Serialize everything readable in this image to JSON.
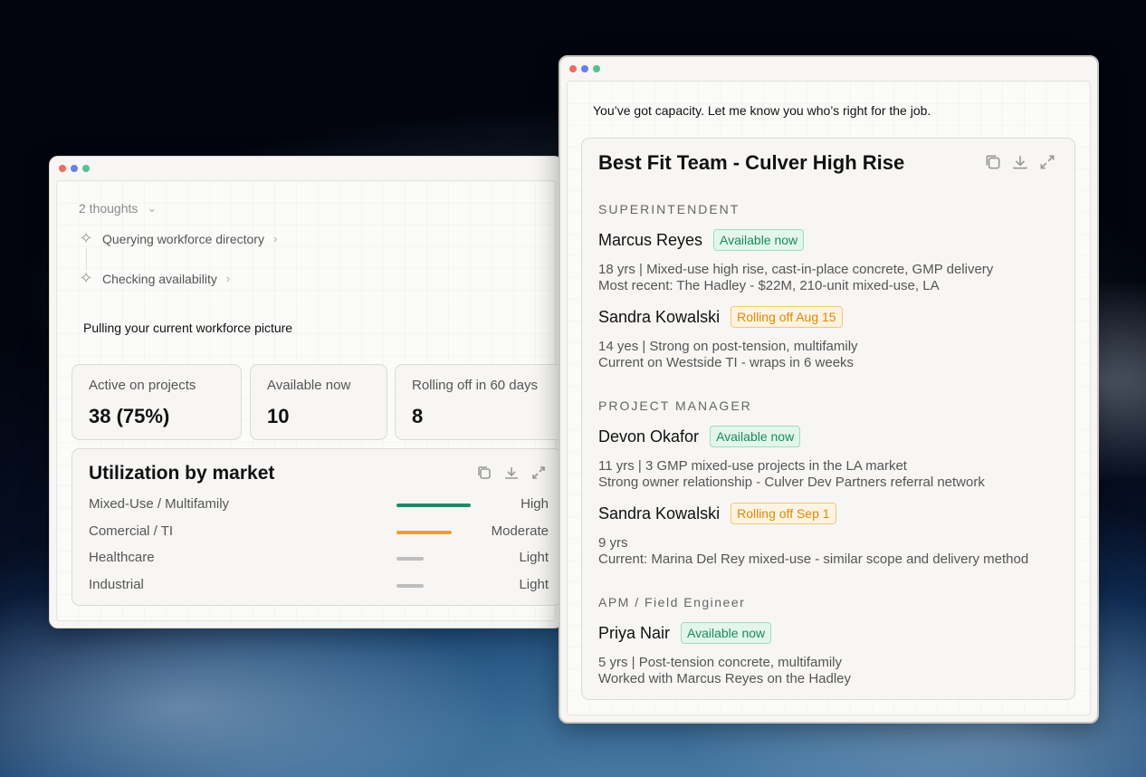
{
  "left_window": {
    "thoughts_label": "2 thoughts",
    "steps": [
      {
        "label": "Querying workforce directory"
      },
      {
        "label": "Checking availability"
      }
    ],
    "message": "Pulling your current workforce picture",
    "stats": [
      {
        "label": "Active on projects",
        "value": "38 (75%)"
      },
      {
        "label": "Available now",
        "value": "10"
      },
      {
        "label": "Rolling off in 60 days",
        "value": "8"
      }
    ],
    "utilization": {
      "title": "Utilization by market",
      "rows": [
        {
          "market": "Mixed-Use / Multifamily",
          "level": "High",
          "fraction": 1.0,
          "color": "#1f8a68"
        },
        {
          "market": "Comercial / TI",
          "level": "Moderate",
          "fraction": 0.74,
          "color": "#e8a22a"
        },
        {
          "market": "Healthcare",
          "level": "Light",
          "fraction": 0.36,
          "color": "#bdbdbd"
        },
        {
          "market": "Industrial",
          "level": "Light",
          "fraction": 0.36,
          "color": "#bdbdbd"
        }
      ]
    }
  },
  "right_window": {
    "message": "You’ve got capacity. Let me know you who’s right for the job.",
    "card": {
      "title": "Best Fit Team - Culver High Rise",
      "roles": [
        {
          "role": "SUPERINTENDENT",
          "people": [
            {
              "name": "Marcus Reyes",
              "status": "Available now",
              "status_type": "available",
              "line1": "18 yrs | Mixed-use high rise, cast-in-place concrete, GMP delivery",
              "line2": "Most recent: The Hadley - $22M, 210-unit mixed-use, LA"
            },
            {
              "name": "Sandra Kowalski",
              "status": "Rolling off Aug 15",
              "status_type": "rolling",
              "line1": "14 yes | Strong on post-tension, multifamily",
              "line2": "Current on Westside TI - wraps in 6 weeks"
            }
          ]
        },
        {
          "role": "PROJECT MANAGER",
          "people": [
            {
              "name": "Devon Okafor",
              "status": "Available now",
              "status_type": "available",
              "line1": "11 yrs | 3 GMP mixed-use projects in the LA market",
              "line2": "Strong owner relationship - Culver Dev Partners referral network"
            },
            {
              "name": "Sandra Kowalski",
              "status": "Rolling off Sep 1",
              "status_type": "rolling",
              "line1": "9 yrs",
              "line2": "Current: Marina Del Rey mixed-use - similar scope and delivery method"
            }
          ]
        },
        {
          "role": "APM / Field Engineer",
          "people": [
            {
              "name": "Priya Nair",
              "status": "Available now",
              "status_type": "available",
              "line1": "5 yrs  | Post-tension concrete, multifamily",
              "line2": "Worked with Marcus Reyes on the Hadley"
            }
          ]
        }
      ]
    }
  },
  "icons": {
    "chevron_down": "chevron-down-icon",
    "chevron_right": "chevron-right-icon",
    "sparkle": "sparkle-icon",
    "copy": "copy-icon",
    "download": "download-icon",
    "expand": "expand-icon"
  }
}
